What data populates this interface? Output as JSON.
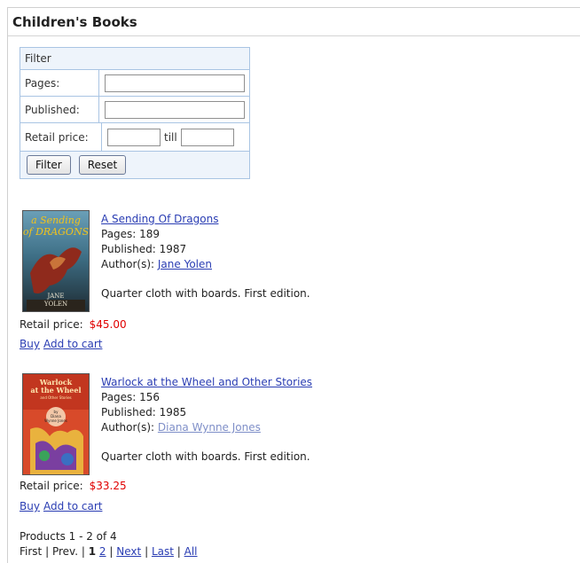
{
  "page": {
    "title": "Children's Books"
  },
  "filter": {
    "heading": "Filter",
    "pages_label": "Pages:",
    "pages_value": "",
    "published_label": "Published:",
    "published_value": "",
    "price_label": "Retail price:",
    "price_from": "",
    "till_label": "till",
    "price_to": "",
    "filter_button": "Filter",
    "reset_button": "Reset"
  },
  "products": [
    {
      "title": "A Sending Of Dragons",
      "pages": "Pages: 189",
      "published": "Published: 1987",
      "authors_label": "Author(s):",
      "author": "Jane Yolen",
      "description": "Quarter cloth with boards. First edition.",
      "price_label": "Retail price:",
      "price": "$45.00",
      "buy": "Buy",
      "add_to_cart": "Add to cart",
      "cover_text": "a Sending of DRAGONS",
      "cover_author": "JANE YOLEN"
    },
    {
      "title": "Warlock at the Wheel and Other Stories",
      "pages": "Pages: 156",
      "published": "Published: 1985",
      "authors_label": "Author(s):",
      "author": "Diana Wynne Jones",
      "description": "Quarter cloth with boards. First edition.",
      "price_label": "Retail price:",
      "price": "$33.25",
      "buy": "Buy",
      "add_to_cart": "Add to cart",
      "cover_text": "Warlock at the Wheel",
      "cover_author": "by Diana Wynne Jones"
    }
  ],
  "pager": {
    "summary": "Products 1 - 2 of 4",
    "first": "First",
    "prev": "Prev.",
    "page1": "1",
    "page2": "2",
    "next": "Next",
    "last": "Last",
    "all": "All",
    "sep": "|"
  }
}
